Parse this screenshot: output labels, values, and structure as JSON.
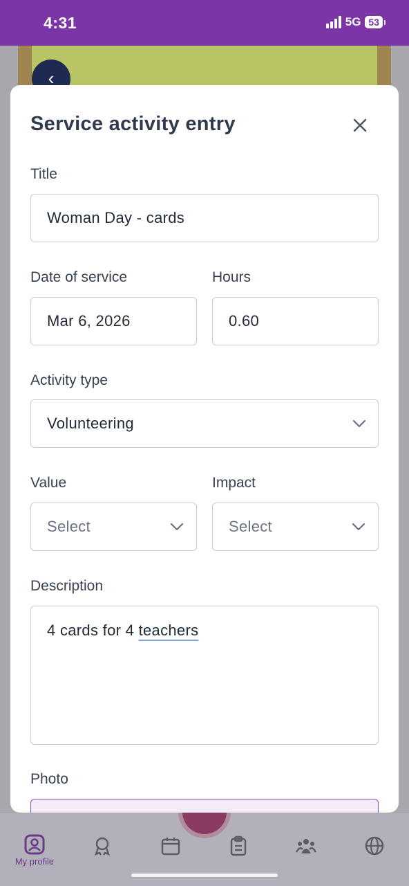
{
  "status_bar": {
    "time": "4:31",
    "network": "5G",
    "battery": "53"
  },
  "modal": {
    "title": "Service activity entry",
    "fields": {
      "title": {
        "label": "Title",
        "value": "Woman Day - cards"
      },
      "date": {
        "label": "Date of service",
        "value": "Mar 6, 2026"
      },
      "hours": {
        "label": "Hours",
        "value": "0.60"
      },
      "activity_type": {
        "label": "Activity type",
        "value": "Volunteering"
      },
      "value": {
        "label": "Value",
        "placeholder": "Select"
      },
      "impact": {
        "label": "Impact",
        "placeholder": "Select"
      },
      "description": {
        "label": "Description",
        "text_before": "4 cards for 4 ",
        "text_underlined": "teachers"
      },
      "photo": {
        "label": "Photo"
      }
    }
  },
  "bottom_nav": {
    "items": [
      {
        "label": "My profile",
        "icon": "profile-icon"
      },
      {
        "icon": "award-icon"
      },
      {
        "icon": "calendar-icon"
      },
      {
        "icon": "clipboard-icon"
      },
      {
        "icon": "people-icon"
      },
      {
        "icon": "globe-icon"
      }
    ]
  },
  "colors": {
    "accent": "#7b35a7",
    "border": "#c7ccda"
  }
}
